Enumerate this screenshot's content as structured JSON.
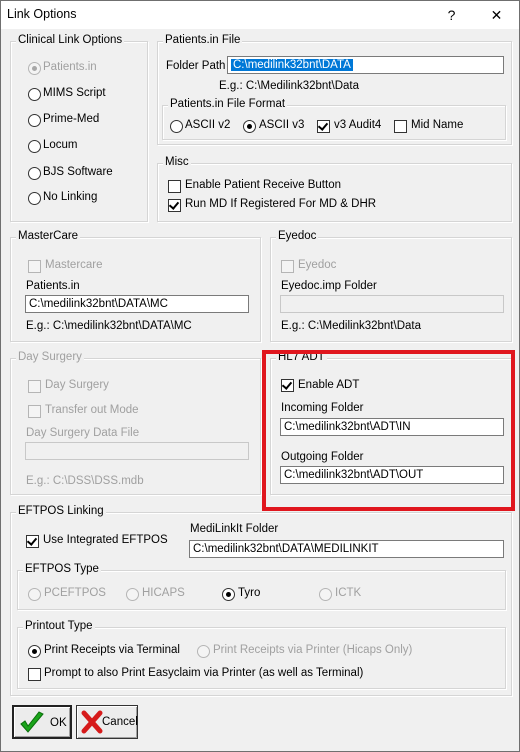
{
  "window": {
    "title": "Link Options",
    "help_glyph": "?",
    "close_glyph": "✕"
  },
  "clinical": {
    "title": "Clinical Link Options",
    "options": [
      {
        "label": "Patients.in",
        "checked": true,
        "disabled": true
      },
      {
        "label": "MIMS Script",
        "checked": false,
        "disabled": false
      },
      {
        "label": "Prime-Med",
        "checked": false,
        "disabled": false
      },
      {
        "label": "Locum",
        "checked": false,
        "disabled": false
      },
      {
        "label": "BJS Software",
        "checked": false,
        "disabled": false
      },
      {
        "label": "No Linking",
        "checked": false,
        "disabled": false
      }
    ]
  },
  "patients_file": {
    "title": "Patients.in File",
    "folder_label": "Folder Path",
    "folder_value": "C:\\medilink32bnt\\DATA",
    "eg": "E.g.:  C:\\Medilink32bnt\\Data",
    "format": {
      "title": "Patients.in File Format",
      "ascii_v2": "ASCII v2",
      "ascii_v3": "ASCII v3",
      "v3_audit4": "v3 Audit4",
      "mid_name": "Mid Name"
    }
  },
  "misc": {
    "title": "Misc",
    "enable_receive": "Enable Patient Receive Button",
    "run_md": "Run MD If Registered For MD & DHR"
  },
  "mastercare": {
    "title": "MasterCare",
    "checkbox": "Mastercare",
    "patients_label": "Patients.in",
    "patients_value": "C:\\medilink32bnt\\DATA\\MC",
    "eg": "E.g.:  C:\\medilink32bnt\\DATA\\MC"
  },
  "eyedoc": {
    "title": "Eyedoc",
    "checkbox": "Eyedoc",
    "folder_label": "Eyedoc.imp Folder",
    "folder_value": "",
    "eg": "E.g.:   C:\\Medilink32bnt\\Data"
  },
  "day_surgery": {
    "title": "Day Surgery",
    "checkbox": "Day Surgery",
    "transfer": "Transfer out Mode",
    "file_label": "Day Surgery Data File",
    "file_value": "",
    "eg": "E.g.:  C:\\DSS\\DSS.mdb"
  },
  "hl7": {
    "title": "HL7 ADT",
    "enable": "Enable ADT",
    "incoming_label": "Incoming Folder",
    "incoming_value": "C:\\medilink32bnt\\ADT\\IN",
    "outgoing_label": "Outgoing Folder",
    "outgoing_value": "C:\\medilink32bnt\\ADT\\OUT",
    "highlight_color": "#e0161e"
  },
  "eftpos": {
    "title": "EFTPOS Linking",
    "use_integrated": "Use Integrated EFTPOS",
    "medilinkit_label": "MediLinkIt Folder",
    "medilinkit_value": "C:\\medilink32bnt\\DATA\\MEDILINKIT",
    "type": {
      "title": "EFTPOS Type",
      "pceftpos": "PCEFTPOS",
      "hicaps": "HICAPS",
      "tyro": "Tyro",
      "ictk": "ICTK"
    },
    "printout": {
      "title": "Printout Type",
      "via_terminal": "Print Receipts via Terminal",
      "via_printer": "Print Receipts via Printer (Hicaps Only)",
      "prompt": "Prompt to also Print Easyclaim via Printer (as well as Terminal)"
    }
  },
  "buttons": {
    "ok": "OK",
    "cancel": "Cancel"
  }
}
